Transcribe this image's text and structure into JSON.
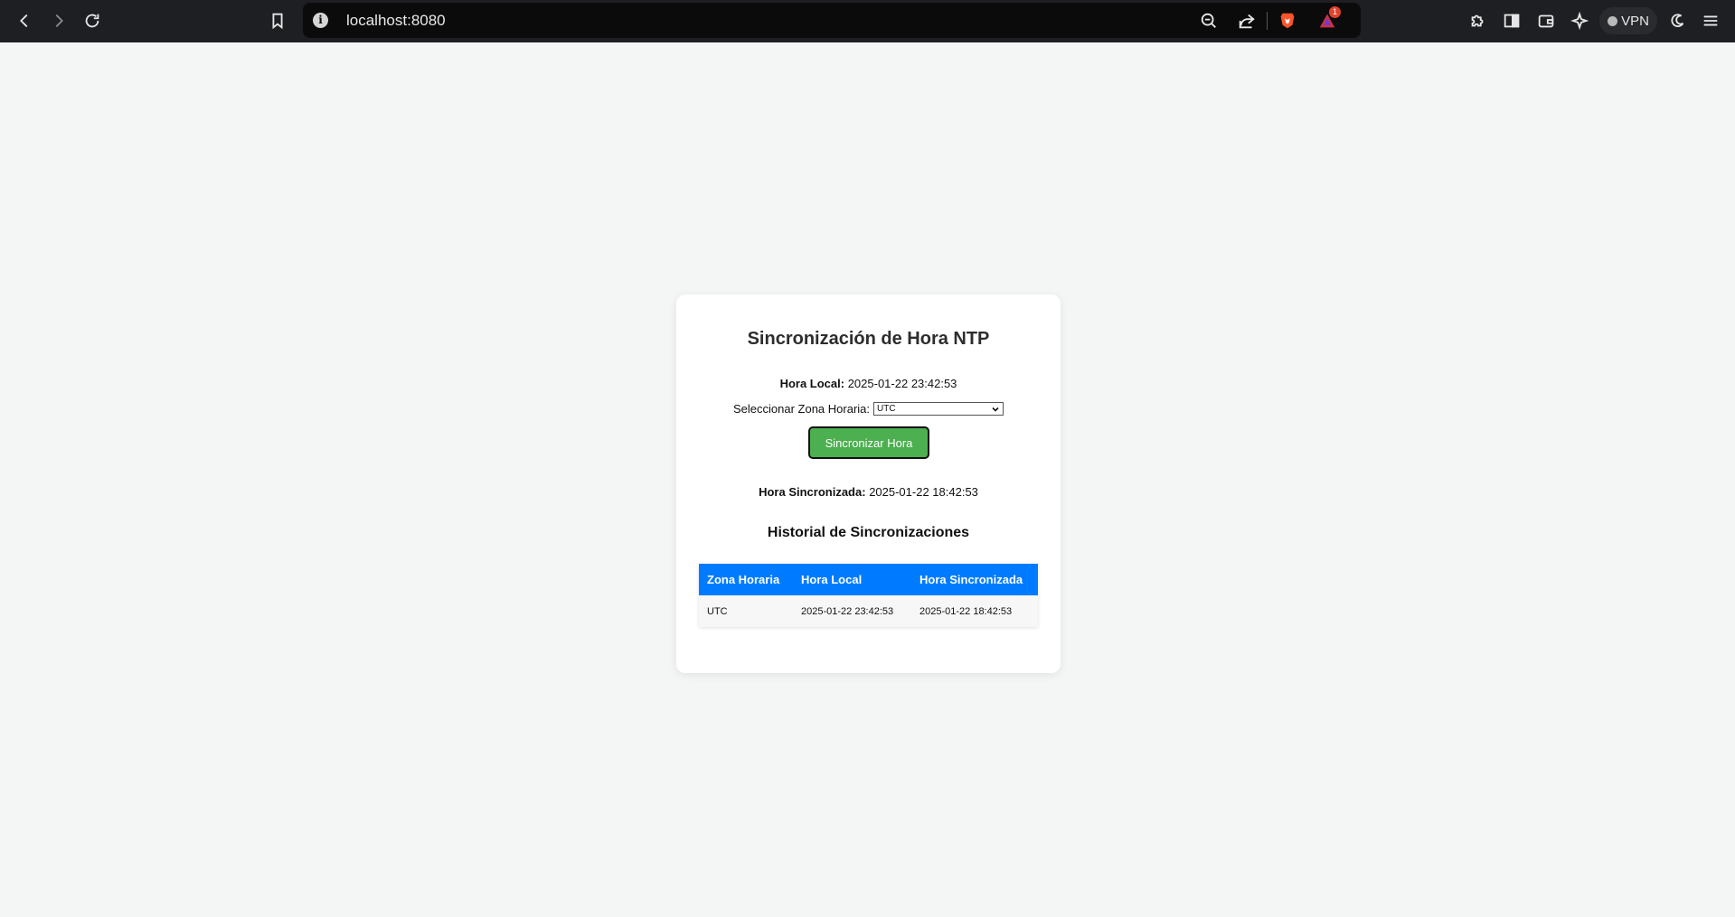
{
  "browser": {
    "url": "localhost:8080",
    "notification_count": "1",
    "vpn_label": "VPN",
    "info_glyph": "i"
  },
  "page": {
    "title": "Sincronización de Hora NTP",
    "local_time_label": "Hora Local:",
    "local_time_value": "2025-01-22 23:42:53",
    "timezone_label": "Seleccionar Zona Horaria:",
    "timezone_selected": "UTC",
    "sync_button_label": "Sincronizar Hora",
    "synced_time_label": "Hora Sincronizada:",
    "synced_time_value": "2025-01-22 18:42:53",
    "history_title": "Historial de Sincronizaciones",
    "history_table": {
      "headers": [
        "Zona Horaria",
        "Hora Local",
        "Hora Sincronizada"
      ],
      "rows": [
        [
          "UTC",
          "2025-01-22 23:42:53",
          "2025-01-22 18:42:53"
        ]
      ]
    }
  },
  "colors": {
    "accent_table_header": "#007bff",
    "sync_button": "#4caf50",
    "page_background": "#f4f6f5"
  }
}
